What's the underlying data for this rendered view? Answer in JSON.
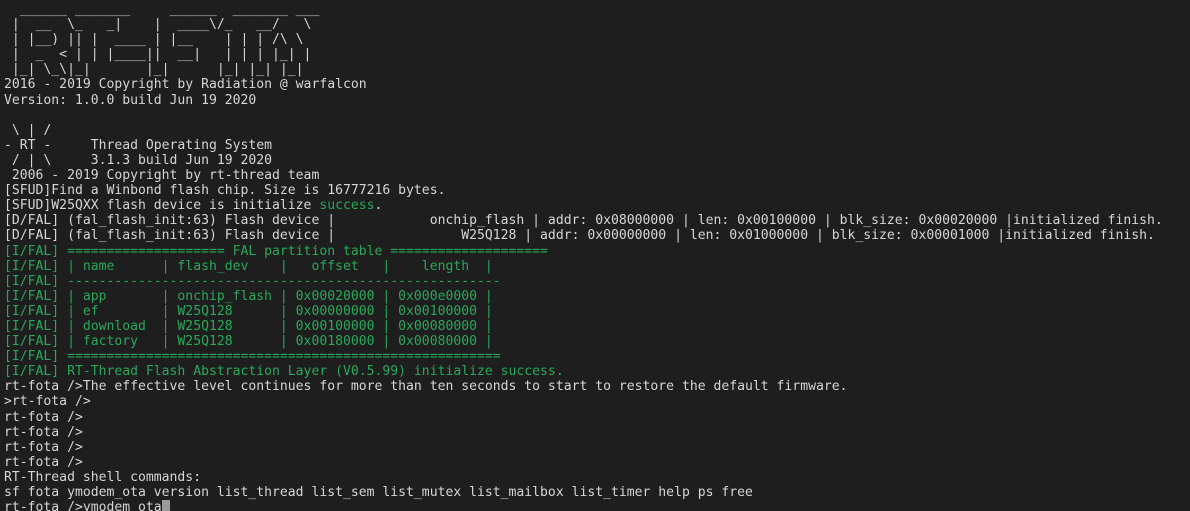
{
  "terminal": {
    "title": "RT-FOTA Bootloader Console",
    "colors": {
      "background": "#1e1e1e",
      "foreground": "#d6d6d6",
      "green": "#2aa85a",
      "cursor": "#9a9a9a"
    },
    "cursor": {
      "glyph": " ",
      "visible": true
    },
    "lines": [
      {
        "id": "logo-1",
        "segments": [
          {
            "text": "  ______ _______     ______  _______ ___",
            "color": "white"
          }
        ]
      },
      {
        "id": "logo-2",
        "segments": [
          {
            "text": " |  __  \\_   _|    |  ____\\/_   __/   \\",
            "color": "white"
          }
        ]
      },
      {
        "id": "logo-3",
        "segments": [
          {
            "text": " | |__) || |  ____ | |__    | | | /\\ \\",
            "color": "white"
          }
        ]
      },
      {
        "id": "logo-4",
        "segments": [
          {
            "text": " |  _  < | | |____||  __|   | | | |_| |",
            "color": "white"
          }
        ]
      },
      {
        "id": "logo-5",
        "segments": [
          {
            "text": " |_| \\_\\|_|       |_|      |_| |_| |_|",
            "color": "white"
          }
        ]
      },
      {
        "id": "copyright-fota",
        "segments": [
          {
            "text": "2016 - 2019 Copyright by Radiation @ warfalcon",
            "color": "white"
          }
        ]
      },
      {
        "id": "version-fota",
        "segments": [
          {
            "text": "Version: 1.0.0 build Jun 19 2020",
            "color": "white"
          }
        ]
      },
      {
        "id": "blank-1",
        "segments": [
          {
            "text": "",
            "color": "white"
          }
        ]
      },
      {
        "id": "rtt-logo-1",
        "segments": [
          {
            "text": " \\ | /",
            "color": "white"
          }
        ]
      },
      {
        "id": "rtt-logo-2",
        "segments": [
          {
            "text": "- RT -     Thread Operating System",
            "color": "white"
          }
        ]
      },
      {
        "id": "rtt-logo-3",
        "segments": [
          {
            "text": " / | \\     3.1.3 build Jun 19 2020",
            "color": "white"
          }
        ]
      },
      {
        "id": "rtt-copyright",
        "segments": [
          {
            "text": " 2006 - 2019 Copyright by rt-thread team",
            "color": "white"
          }
        ]
      },
      {
        "id": "sfud-find",
        "segments": [
          {
            "text": "[SFUD]Find a Winbond flash chip. Size is 16777216 bytes.",
            "color": "white"
          }
        ]
      },
      {
        "id": "sfud-init",
        "segments": [
          {
            "text": "[SFUD]W25QXX flash device is initialize ",
            "color": "white"
          },
          {
            "text": "success",
            "color": "green"
          },
          {
            "text": ".",
            "color": "white"
          }
        ]
      },
      {
        "id": "dfal-onchip",
        "segments": [
          {
            "text": "[D/FAL] (fal_flash_init:63) Flash device |            onchip_flash | addr: 0x08000000 | len: 0x00100000 | blk_size: 0x00020000 |initialized finish.",
            "color": "white"
          }
        ]
      },
      {
        "id": "dfal-w25q128",
        "segments": [
          {
            "text": "[D/FAL] (fal_flash_init:63) Flash device |                W25Q128 | addr: 0x00000000 | len: 0x01000000 | blk_size: 0x00001000 |initialized finish.",
            "color": "white"
          }
        ]
      },
      {
        "id": "ifal-table-top",
        "segments": [
          {
            "text": "[I/FAL] ==================== FAL partition table ====================",
            "color": "green"
          }
        ]
      },
      {
        "id": "ifal-header",
        "segments": [
          {
            "text": "[I/FAL] | name      | flash_dev    |   offset   |    length  |",
            "color": "green"
          }
        ]
      },
      {
        "id": "ifal-divider",
        "segments": [
          {
            "text": "[I/FAL] -------------------------------------------------------",
            "color": "green"
          }
        ]
      },
      {
        "id": "ifal-row-app",
        "segments": [
          {
            "text": "[I/FAL] | app       | onchip_flash | 0x00020000 | 0x000e0000 |",
            "color": "green"
          }
        ]
      },
      {
        "id": "ifal-row-ef",
        "segments": [
          {
            "text": "[I/FAL] | ef        | W25Q128      | 0x00000000 | 0x00100000 |",
            "color": "green"
          }
        ]
      },
      {
        "id": "ifal-row-download",
        "segments": [
          {
            "text": "[I/FAL] | download  | W25Q128      | 0x00100000 | 0x00080000 |",
            "color": "green"
          }
        ]
      },
      {
        "id": "ifal-row-factory",
        "segments": [
          {
            "text": "[I/FAL] | factory   | W25Q128      | 0x00180000 | 0x00080000 |",
            "color": "green"
          }
        ]
      },
      {
        "id": "ifal-table-bottom",
        "segments": [
          {
            "text": "[I/FAL] =======================================================",
            "color": "green"
          }
        ]
      },
      {
        "id": "ifal-success",
        "segments": [
          {
            "text": "[I/FAL] RT-Thread Flash Abstraction Layer (V0.5.99) initialize success.",
            "color": "green"
          }
        ]
      },
      {
        "id": "prompt-effective",
        "segments": [
          {
            "text": "rt-fota />The effective level continues for more than ten seconds to start to restore the default firmware.",
            "color": "white"
          }
        ]
      },
      {
        "id": "prompt-2",
        "segments": [
          {
            "text": ">rt-fota />",
            "color": "white"
          }
        ]
      },
      {
        "id": "prompt-3",
        "segments": [
          {
            "text": "rt-fota />",
            "color": "white"
          }
        ]
      },
      {
        "id": "prompt-4",
        "segments": [
          {
            "text": "rt-fota />",
            "color": "white"
          }
        ]
      },
      {
        "id": "prompt-5",
        "segments": [
          {
            "text": "rt-fota />",
            "color": "white"
          }
        ]
      },
      {
        "id": "prompt-6",
        "segments": [
          {
            "text": "rt-fota />",
            "color": "white"
          }
        ]
      },
      {
        "id": "shell-commands-header",
        "segments": [
          {
            "text": "RT-Thread shell commands:",
            "color": "white"
          }
        ]
      },
      {
        "id": "shell-commands-list",
        "segments": [
          {
            "text": "sf fota ymodem_ota version list_thread list_sem list_mutex list_mailbox list_timer help ps free",
            "color": "white"
          }
        ]
      },
      {
        "id": "prompt-current",
        "segments": [
          {
            "text": "rt-fota />ymodem_ota",
            "color": "white"
          },
          {
            "text": " ",
            "color": "cursor"
          }
        ]
      }
    ]
  },
  "shell_commands": [
    "sf",
    "fota",
    "ymodem_ota",
    "version",
    "list_thread",
    "list_sem",
    "list_mutex",
    "list_mailbox",
    "list_timer",
    "help",
    "ps",
    "free"
  ],
  "fal_partition_table": {
    "title": "FAL partition table",
    "columns": [
      "name",
      "flash_dev",
      "offset",
      "length"
    ],
    "rows": [
      {
        "name": "app",
        "flash_dev": "onchip_flash",
        "offset": "0x00020000",
        "length": "0x000e0000"
      },
      {
        "name": "ef",
        "flash_dev": "W25Q128",
        "offset": "0x00000000",
        "length": "0x00100000"
      },
      {
        "name": "download",
        "flash_dev": "W25Q128",
        "offset": "0x00100000",
        "length": "0x00080000"
      },
      {
        "name": "factory",
        "flash_dev": "W25Q128",
        "offset": "0x00180000",
        "length": "0x00080000"
      }
    ]
  },
  "flash_devices": [
    {
      "name": "onchip_flash",
      "addr": "0x08000000",
      "len": "0x00100000",
      "blk_size": "0x00020000",
      "status": "initialized finish."
    },
    {
      "name": "W25Q128",
      "addr": "0x00000000",
      "len": "0x01000000",
      "blk_size": "0x00001000",
      "status": "initialized finish."
    }
  ],
  "versions": {
    "fota_version": "1.0.0",
    "fota_build": "Jun 19 2020",
    "rtthread_version": "3.1.3",
    "rtthread_build": "Jun 19 2020",
    "fal_version": "V0.5.99"
  },
  "current_input": "ymodem_ota",
  "prompt": "rt-fota />"
}
